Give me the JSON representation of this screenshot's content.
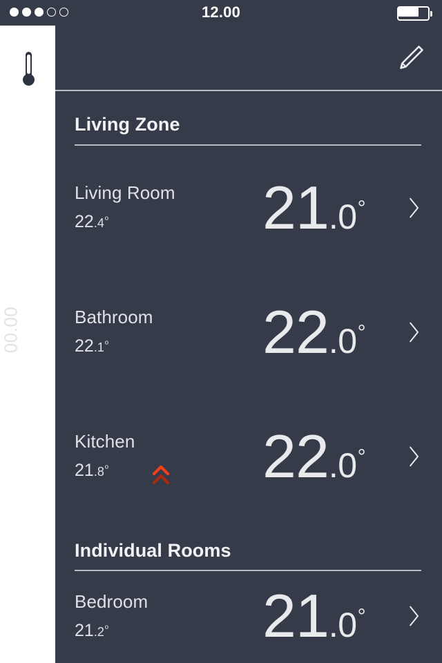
{
  "status_bar": {
    "time": "12.00",
    "signal_dots_total": 5,
    "signal_dots_filled": 3,
    "battery_percent": 70,
    "battery_icon": "battery-icon"
  },
  "rail": {
    "active_icon": "thermometer-icon",
    "vertical_label": "00.00",
    "background_color": "#ffffff"
  },
  "header": {
    "edit_icon": "pencil-icon"
  },
  "theme": {
    "background": "#353b49",
    "text_primary": "#e9eaec",
    "divider": "#b9bcc2",
    "heat_accent": "#f0401a",
    "heat_accent_dim": "#b32d13"
  },
  "sections": [
    {
      "title": "Living Zone",
      "rooms": [
        {
          "name": "Living Room",
          "current_int": "22",
          "current_dec": ".4",
          "current_deg": "º",
          "target_int": "21",
          "target_dec": ".0",
          "target_deg": "°",
          "heating": false,
          "chevron": "chevron-right-icon"
        },
        {
          "name": "Bathroom",
          "current_int": "22",
          "current_dec": ".1",
          "current_deg": "º",
          "target_int": "22",
          "target_dec": ".0",
          "target_deg": "°",
          "heating": false,
          "chevron": "chevron-right-icon"
        },
        {
          "name": "Kitchen",
          "current_int": "21",
          "current_dec": ".8",
          "current_deg": "º",
          "target_int": "22",
          "target_dec": ".0",
          "target_deg": "°",
          "heating": true,
          "chevron": "chevron-right-icon"
        }
      ]
    },
    {
      "title": "Individual Rooms",
      "rooms": [
        {
          "name": "Bedroom",
          "current_int": "21",
          "current_dec": ".2",
          "current_deg": "º",
          "target_int": "21",
          "target_dec": ".0",
          "target_deg": "°",
          "heating": false,
          "chevron": "chevron-right-icon"
        }
      ]
    }
  ]
}
